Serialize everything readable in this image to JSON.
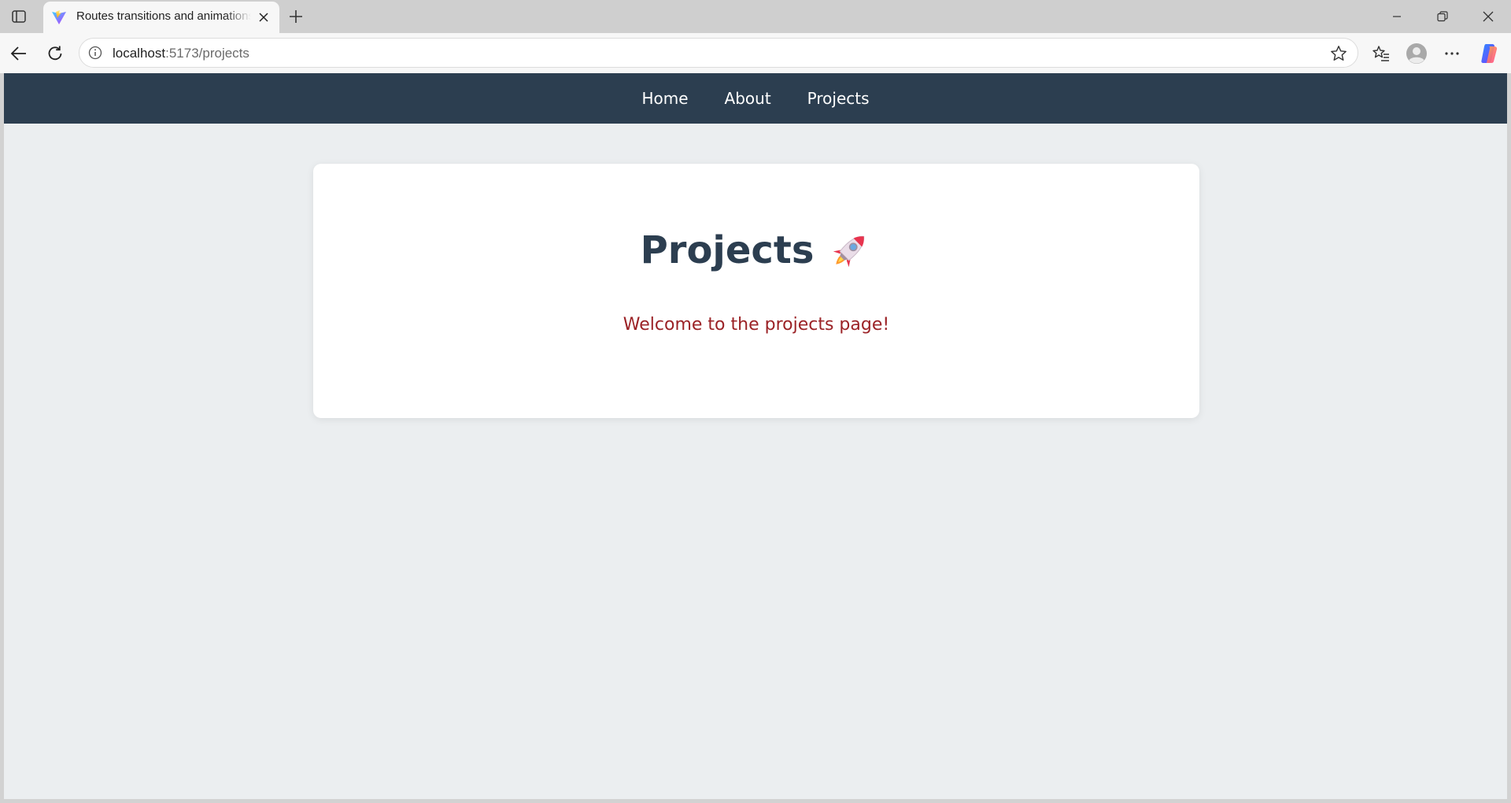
{
  "browser": {
    "tab": {
      "title": "Routes transitions and animations",
      "favicon": "vite-logo-icon"
    },
    "address_bar": {
      "host": "localhost",
      "path": ":5173/projects"
    },
    "icons": {
      "sidebar": "sidebar-toggle-icon",
      "new_tab": "plus-icon",
      "back": "back-arrow-icon",
      "reload": "reload-icon",
      "site_info": "info-icon",
      "favorite": "star-icon",
      "favorites_list": "favorites-icon",
      "profile": "profile-icon",
      "menu": "more-icon",
      "copilot": "copilot-icon",
      "minimize": "minimize-icon",
      "restore": "restore-icon",
      "close": "close-icon"
    }
  },
  "page": {
    "nav": {
      "items": [
        {
          "label": "Home"
        },
        {
          "label": "About"
        },
        {
          "label": "Projects"
        }
      ]
    },
    "card": {
      "title": "Projects",
      "subtitle": "Welcome to the projects page!",
      "title_icon": "rocket-icon"
    }
  },
  "colors": {
    "nav_bg": "#2c3e50",
    "title": "#2c3e50",
    "subtitle": "#9b2226",
    "page_bg": "#ebeef0",
    "card_bg": "#ffffff"
  }
}
